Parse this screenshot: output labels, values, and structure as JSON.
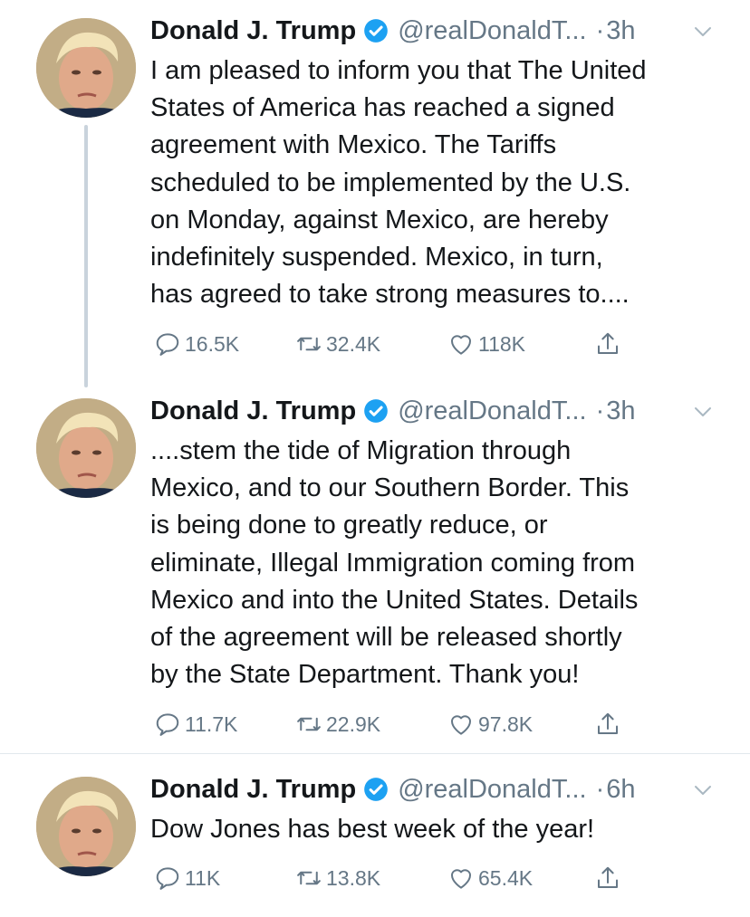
{
  "tweets": [
    {
      "name": "Donald J. Trump",
      "handle": "@realDonaldT...",
      "dot": "·",
      "time": "3h",
      "lines": [
        "I am pleased to inform you that The United",
        "States of America has reached a signed",
        "agreement with Mexico. The Tariffs",
        "scheduled to be implemented by the U.S.",
        "on Monday, against Mexico, are hereby",
        "indefinitely suspended. Mexico, in turn,",
        "has agreed to take strong measures to...."
      ],
      "replies": "16.5K",
      "retweets": "32.4K",
      "likes": "118K"
    },
    {
      "name": "Donald J. Trump",
      "handle": "@realDonaldT...",
      "dot": "·",
      "time": "3h",
      "lines": [
        "....stem the tide of Migration through",
        "Mexico, and to our Southern Border. This",
        "is being done to greatly reduce, or",
        "eliminate, Illegal Immigration coming from",
        "Mexico and into the United States. Details",
        "of the agreement will be released shortly",
        "by the State Department. Thank you!"
      ],
      "replies": "11.7K",
      "retweets": "22.9K",
      "likes": "97.8K"
    },
    {
      "name": "Donald J. Trump",
      "handle": "@realDonaldT...",
      "dot": "·",
      "time": "6h",
      "lines": [
        "Dow Jones has best week of the year!"
      ],
      "replies": "11K",
      "retweets": "13.8K",
      "likes": "65.4K"
    }
  ],
  "icons": {
    "reply": "reply-icon",
    "retweet": "retweet-icon",
    "like": "heart-icon",
    "share": "share-icon",
    "verified": "verified-badge-icon",
    "more": "chevron-down-icon"
  },
  "colors": {
    "text": "#14171a",
    "secondary": "#657786",
    "verified": "#1da1f2",
    "thread_line": "#c9d3dc",
    "divider": "#e1e8ed"
  }
}
